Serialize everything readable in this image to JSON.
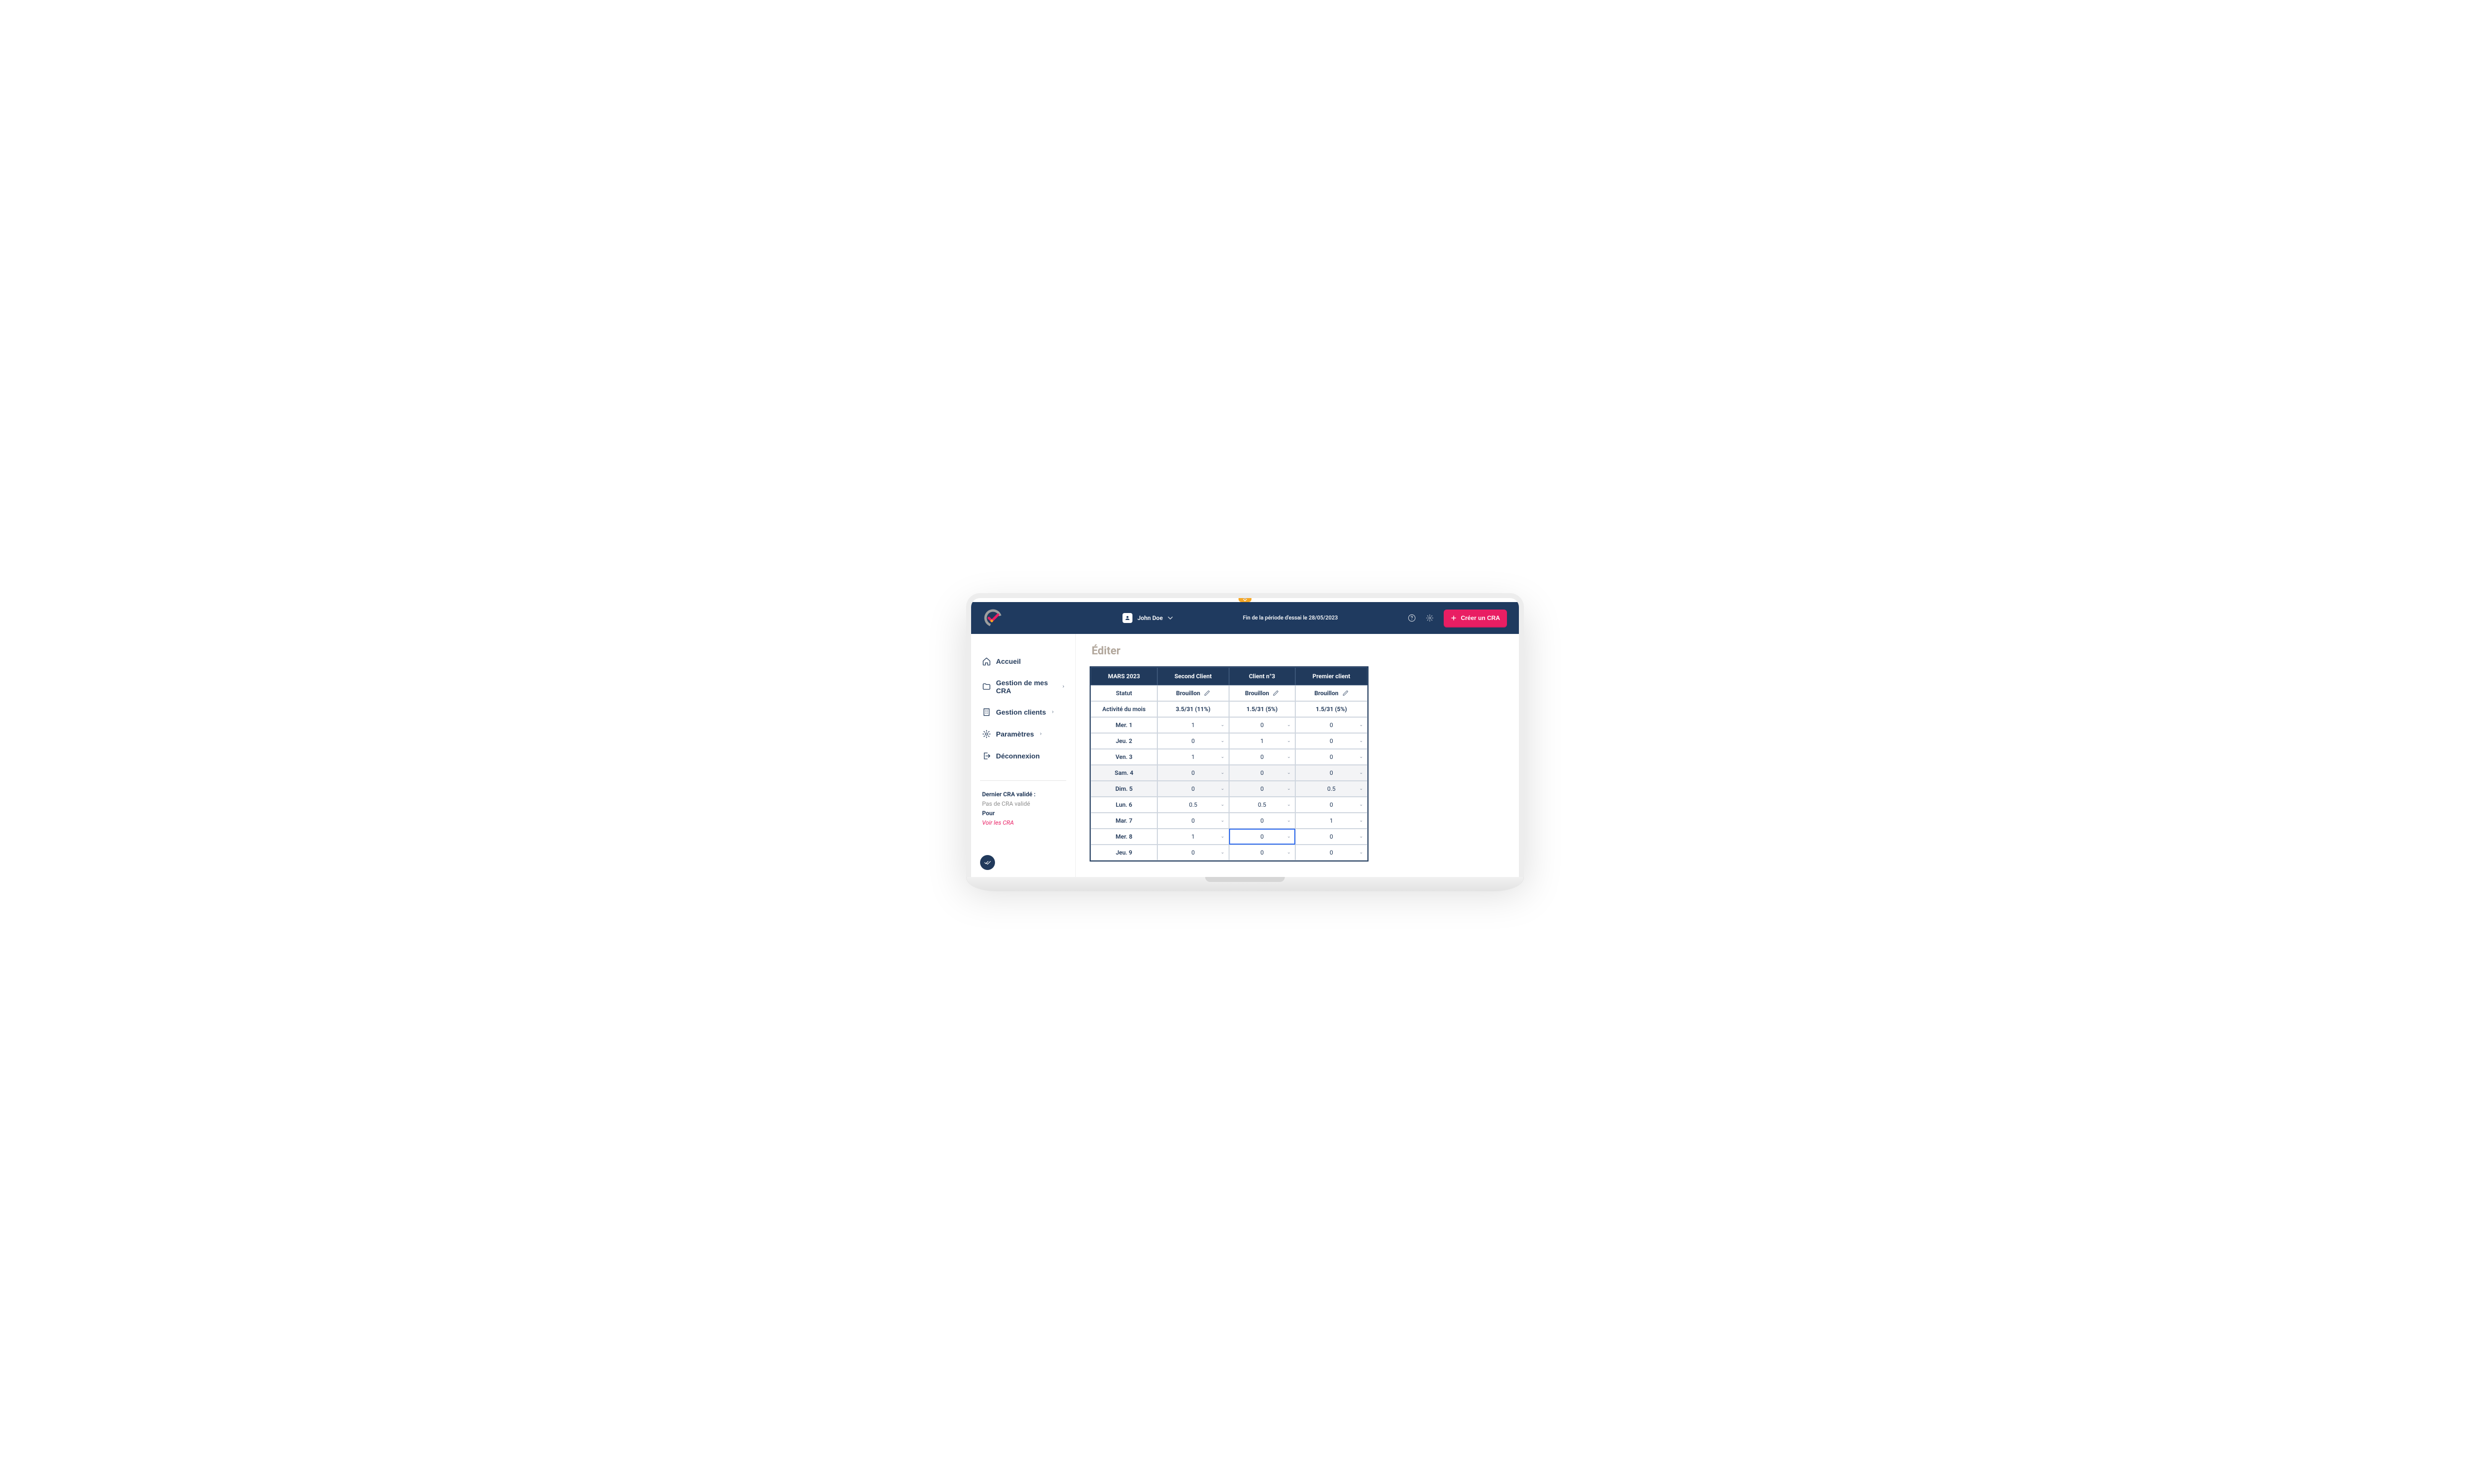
{
  "header": {
    "user_name": "John Doe",
    "trial_text": "Fin de la période d'essai le 28/05/2023",
    "create_label": "Créer un CRA"
  },
  "sidebar": {
    "items": [
      {
        "label": "Accueil",
        "has_children": false
      },
      {
        "label": "Gestion de mes CRA",
        "has_children": true
      },
      {
        "label": "Gestion clients",
        "has_children": true
      },
      {
        "label": "Paramètres",
        "has_children": true
      },
      {
        "label": "Déconnexion",
        "has_children": false
      }
    ],
    "info": {
      "label": "Dernier CRA validé :",
      "value": "Pas de CRA validé",
      "for_label": "Pour",
      "link": "Voir les CRA"
    }
  },
  "page": {
    "title": "Éditer"
  },
  "table": {
    "period": "MARS 2023",
    "clients": [
      "Second Client",
      "Client n°3",
      "Premier client"
    ],
    "status_label": "Statut",
    "statuses": [
      "Brouillon",
      "Brouillon",
      "Brouillon"
    ],
    "activity_label": "Activité du mois",
    "activity": [
      "3.5/31 (11%)",
      "1.5/31 (5%)",
      "1.5/31 (5%)"
    ],
    "rows": [
      {
        "day": "Mer. 1",
        "weekend": false,
        "values": [
          "1",
          "0",
          "0"
        ]
      },
      {
        "day": "Jeu. 2",
        "weekend": false,
        "values": [
          "0",
          "1",
          "0"
        ]
      },
      {
        "day": "Ven. 3",
        "weekend": false,
        "values": [
          "1",
          "0",
          "0"
        ]
      },
      {
        "day": "Sam. 4",
        "weekend": true,
        "values": [
          "0",
          "0",
          "0"
        ]
      },
      {
        "day": "Dim. 5",
        "weekend": true,
        "values": [
          "0",
          "0",
          "0.5"
        ]
      },
      {
        "day": "Lun. 6",
        "weekend": false,
        "values": [
          "0.5",
          "0.5",
          "0"
        ]
      },
      {
        "day": "Mar. 7",
        "weekend": false,
        "values": [
          "0",
          "0",
          "1"
        ]
      },
      {
        "day": "Mer. 8",
        "weekend": false,
        "values": [
          "1",
          "0",
          "0"
        ],
        "focused_col": 1
      },
      {
        "day": "Jeu. 9",
        "weekend": false,
        "values": [
          "0",
          "0",
          "0"
        ]
      }
    ]
  }
}
